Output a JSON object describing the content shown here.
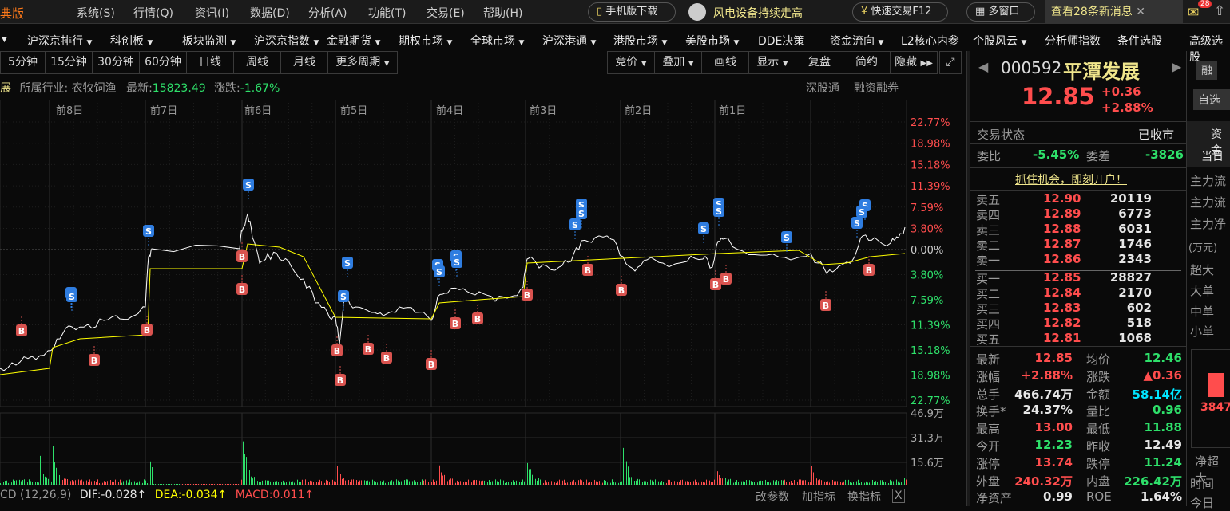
{
  "topbar": {
    "brand": "典版",
    "menus": [
      "系统(S)",
      "行情(Q)",
      "资讯(I)",
      "数据(D)",
      "分析(A)",
      "功能(T)",
      "交易(E)",
      "帮助(H)"
    ],
    "mobile": "手机版下载",
    "news": "风电设备持续走高",
    "quick_trade": "快速交易F12",
    "multi_window": "多窗口",
    "messages": "查看28条新消息",
    "badge": "28"
  },
  "nav": [
    "沪深京排行",
    "科创板",
    "板块监测",
    "沪深京指数",
    "金融期货",
    "期权市场",
    "全球市场",
    "沪深港通",
    "港股市场",
    "美股市场",
    "DDE决策",
    "资金流向",
    "L2核心内参",
    "个股风云",
    "分析师指数",
    "条件选股",
    "高级选股"
  ],
  "periods": [
    "5分钟",
    "15分钟",
    "30分钟",
    "60分钟",
    "日线",
    "周线",
    "月线",
    "更多周期"
  ],
  "chart_tools": [
    "竞价",
    "叠加",
    "画线",
    "显示",
    "复盘",
    "简约",
    "隐藏"
  ],
  "info": {
    "name_tail": "展",
    "industry_label": "所属行业:",
    "industry": "农牧饲渔",
    "latest_label": "最新:",
    "latest": "15823.49",
    "change_label": "涨跌:",
    "change": "-1.67%",
    "tag1": "深股通",
    "tag2": "融资融券"
  },
  "days": [
    "前8日",
    "前7日",
    "前6日",
    "前5日",
    "前4日",
    "前3日",
    "前2日",
    "前1日"
  ],
  "pct_axis": {
    "up": [
      "22.77%",
      "18.98%",
      "15.18%",
      "11.39%",
      "7.59%",
      "3.80%"
    ],
    "zero": "0.00%",
    "down": [
      "3.80%",
      "7.59%",
      "11.39%",
      "15.18%",
      "18.98%",
      "22.77%"
    ]
  },
  "volume_axis": [
    "46.9万",
    "31.3万",
    "15.6万"
  ],
  "macd": {
    "name": "CD (12,26,9)",
    "dif": "DIF:-0.028↑",
    "dea": "DEA:-0.034↑",
    "macd": "MACD:0.011↑",
    "change_params": "改参数",
    "add_indicator": "加指标",
    "switch_indicator": "换指标",
    "close": "X"
  },
  "stock": {
    "code": "000592",
    "name": "平潭发展",
    "price": "12.85",
    "change": "+0.36",
    "change_pct": "+2.88%",
    "rong": "融",
    "zixuan": "自选"
  },
  "status": {
    "label": "交易状态",
    "value": "已收市",
    "weibi_label": "委比",
    "weibi": "-5.45%",
    "weicha_label": "委差",
    "weicha": "-3826",
    "promo": "抓住机会，即刻开户！"
  },
  "asks": [
    {
      "l": "卖五",
      "p": "12.90",
      "v": "20119"
    },
    {
      "l": "卖四",
      "p": "12.89",
      "v": "6773"
    },
    {
      "l": "卖三",
      "p": "12.88",
      "v": "6031"
    },
    {
      "l": "卖二",
      "p": "12.87",
      "v": "1746"
    },
    {
      "l": "卖一",
      "p": "12.86",
      "v": "2343"
    }
  ],
  "bids": [
    {
      "l": "买一",
      "p": "12.85",
      "v": "28827"
    },
    {
      "l": "买二",
      "p": "12.84",
      "v": "2170"
    },
    {
      "l": "买三",
      "p": "12.83",
      "v": "602"
    },
    {
      "l": "买四",
      "p": "12.82",
      "v": "518"
    },
    {
      "l": "买五",
      "p": "12.81",
      "v": "1068"
    }
  ],
  "stats": [
    {
      "l1": "最新",
      "v1": "12.85",
      "c1": "red",
      "l2": "均价",
      "v2": "12.46",
      "c2": "green"
    },
    {
      "l1": "涨幅",
      "v1": "+2.88%",
      "c1": "red",
      "l2": "涨跌",
      "v2": "▲0.36",
      "c2": "red"
    },
    {
      "l1": "总手",
      "v1": "466.74万",
      "c1": "white",
      "l2": "金额",
      "v2": "58.14亿",
      "c2": "cyan"
    },
    {
      "l1": "换手*",
      "v1": "24.37%",
      "c1": "white",
      "l2": "量比",
      "v2": "0.96",
      "c2": "green"
    },
    {
      "l1": "最高",
      "v1": "13.00",
      "c1": "red",
      "l2": "最低",
      "v2": "11.88",
      "c2": "green"
    },
    {
      "l1": "今开",
      "v1": "12.23",
      "c1": "green",
      "l2": "昨收",
      "v2": "12.49",
      "c2": "white"
    },
    {
      "l1": "涨停",
      "v1": "13.74",
      "c1": "red",
      "l2": "跌停",
      "v2": "11.24",
      "c2": "green"
    },
    {
      "l1": "外盘",
      "v1": "240.32万",
      "c1": "red",
      "l2": "内盘",
      "v2": "226.42万",
      "c2": "green"
    },
    {
      "l1": "净资产",
      "v1": "0.99",
      "c1": "white",
      "l2": "ROE",
      "v2": "1.64%",
      "c2": "white"
    }
  ],
  "fund": {
    "tab": "资金",
    "today": "当日",
    "rows": [
      "主力流",
      "主力流",
      "主力净"
    ],
    "unit": "(万元)",
    "sizes": [
      "超大",
      "大单",
      "中单",
      "小单"
    ],
    "bar_value": "3847",
    "net": "净超大",
    "time": "时间",
    "today2": "今日"
  },
  "markers": {
    "buy": "B",
    "sell": "S"
  },
  "colors": {
    "up": "#ff4d4d",
    "down": "#2ee06a",
    "price_line": "#ffffff",
    "avg_line": "#ffff00",
    "sell_marker": "#2f7de0",
    "buy_marker": "#d9534f"
  }
}
